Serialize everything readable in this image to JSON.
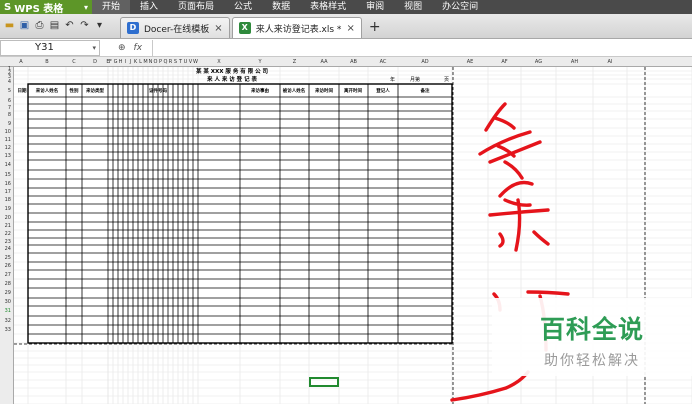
{
  "app": {
    "name": "WPS 表格"
  },
  "menu": {
    "tabs": [
      "开始",
      "插入",
      "页面布局",
      "公式",
      "数据",
      "表格样式",
      "审阅",
      "视图",
      "办公空间"
    ],
    "active": "开始"
  },
  "quick_icons": [
    "open-folder-icon",
    "save-icon",
    "print-icon",
    "print-preview-icon",
    "undo-icon",
    "redo-icon",
    "customize-dropdown-icon"
  ],
  "doc_tabs": [
    {
      "label": "Docer-在线模板",
      "icon": "docer-icon",
      "icon_text": "D",
      "icon_color": "#2f6fcf",
      "active": false
    },
    {
      "label": "来人来访登记表.xls *",
      "icon": "excel-file-icon",
      "icon_text": "X",
      "icon_color": "#2f8a3c",
      "active": true
    }
  ],
  "new_tab_label": "+",
  "close_label": "×",
  "formula_bar": {
    "cell_ref": "Y31",
    "zoom_icon": "⊕",
    "fx_label": "fx",
    "content": ""
  },
  "columns": [
    "A",
    "B",
    "C",
    "D",
    "E",
    "F",
    "G",
    "H",
    "I",
    "J",
    "K",
    "L",
    "M",
    "N",
    "O",
    "P",
    "Q",
    "R",
    "S",
    "T",
    "U",
    "V",
    "W",
    "X",
    "Y",
    "Z",
    "AA",
    "AB",
    "AC",
    "AD",
    "AE",
    "AF",
    "AG",
    "AH",
    "AI"
  ],
  "rows": [
    "1",
    "2",
    "3",
    "4",
    "5",
    "6",
    "7",
    "8",
    "9",
    "10",
    "11",
    "12",
    "13",
    "14",
    "15",
    "16",
    "17",
    "18",
    "19",
    "20",
    "21",
    "22",
    "23",
    "24",
    "25",
    "26",
    "27",
    "28",
    "29",
    "30",
    "31",
    "32",
    "33"
  ],
  "form": {
    "company": "某 某 XXX 服 务 有 限 公 司",
    "title": "来 人 来 访 登 记 表",
    "year_label": "年",
    "month_label": "月第",
    "page_label": "页",
    "headers": [
      "日期",
      "来访人姓名",
      "性别",
      "来访类型",
      "证件号码",
      "来访事由",
      "被访人姓名",
      "来访时间",
      "离开时间",
      "登记人",
      "备注"
    ]
  },
  "annotation": {
    "text": "多余"
  },
  "watermark": {
    "title": "百科全说",
    "subtitle": "助你轻松解决"
  },
  "colors": {
    "menu_bg": "#4a4a4a",
    "wps_green": "#5d9628",
    "ink_red": "#e5141b",
    "selection": "#218a2f",
    "watermark_green": "#2e9c55"
  }
}
